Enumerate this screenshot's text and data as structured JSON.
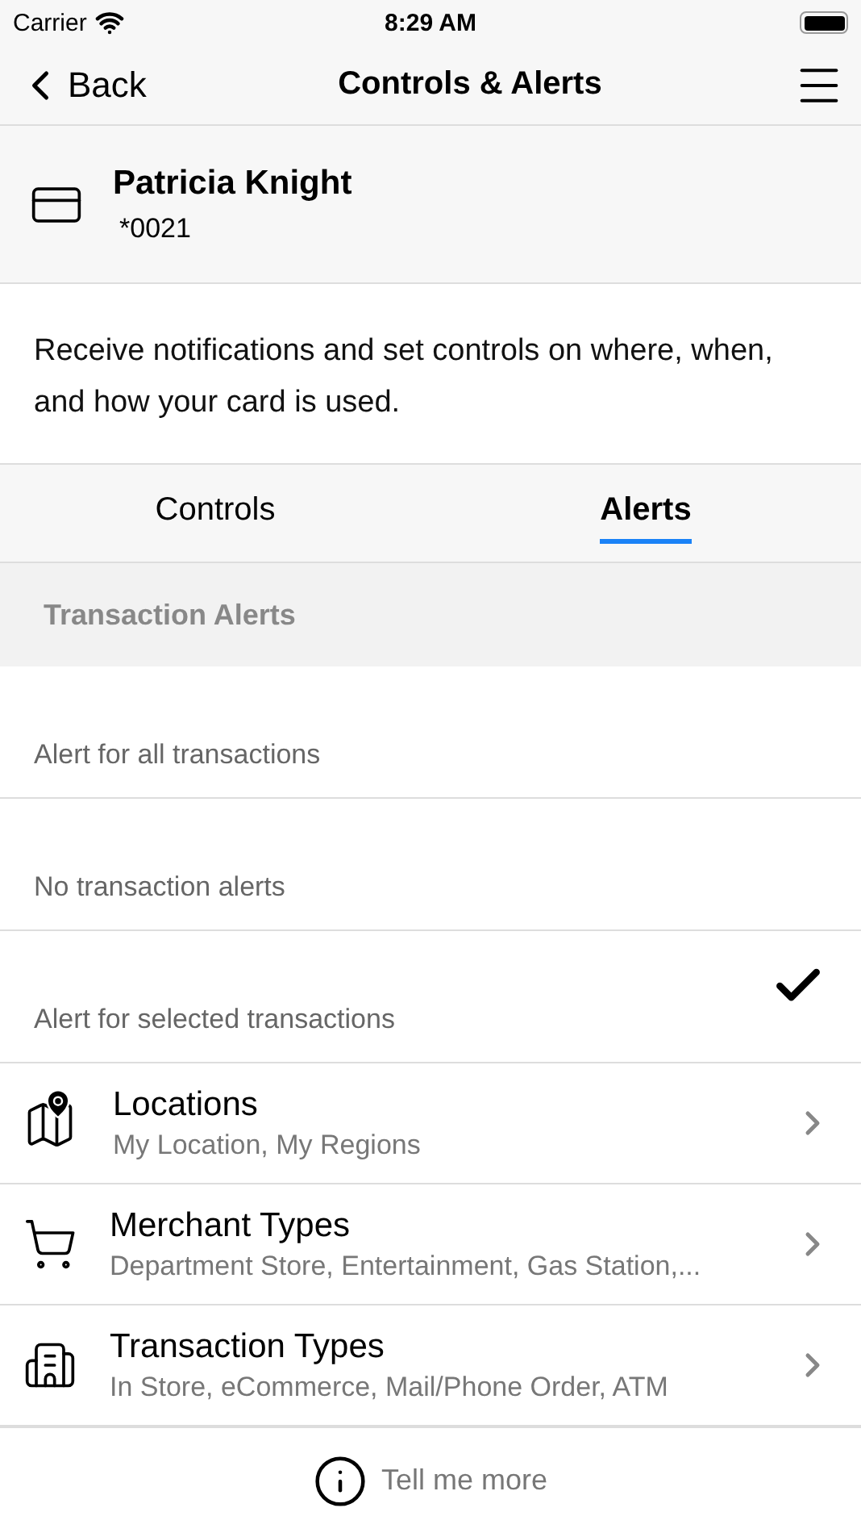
{
  "status_bar": {
    "carrier": "Carrier",
    "time": "8:29 AM"
  },
  "nav": {
    "back": "Back",
    "title": "Controls & Alerts"
  },
  "card": {
    "name": "Patricia Knight",
    "number": "*0021"
  },
  "description": "Receive notifications and set controls on where, when, and how your card is used.",
  "tabs": [
    {
      "label": "Controls",
      "selected": false
    },
    {
      "label": "Alerts",
      "selected": true
    }
  ],
  "section_header": "Transaction Alerts",
  "alert_options": [
    {
      "label": "Alert for all transactions",
      "selected": false
    },
    {
      "label": "No transaction alerts",
      "selected": false
    },
    {
      "label": "Alert for selected transactions",
      "selected": true
    }
  ],
  "categories": [
    {
      "kind": "map",
      "title": "Locations",
      "subtitle": "My Location, My Regions"
    },
    {
      "kind": "cart",
      "title": "Merchant Types",
      "subtitle": "Department Store, Entertainment, Gas Station,..."
    },
    {
      "kind": "buildings",
      "title": "Transaction Types",
      "subtitle": "In Store, eCommerce, Mail/Phone Order, ATM"
    }
  ],
  "footer": {
    "label": "Tell me more"
  }
}
